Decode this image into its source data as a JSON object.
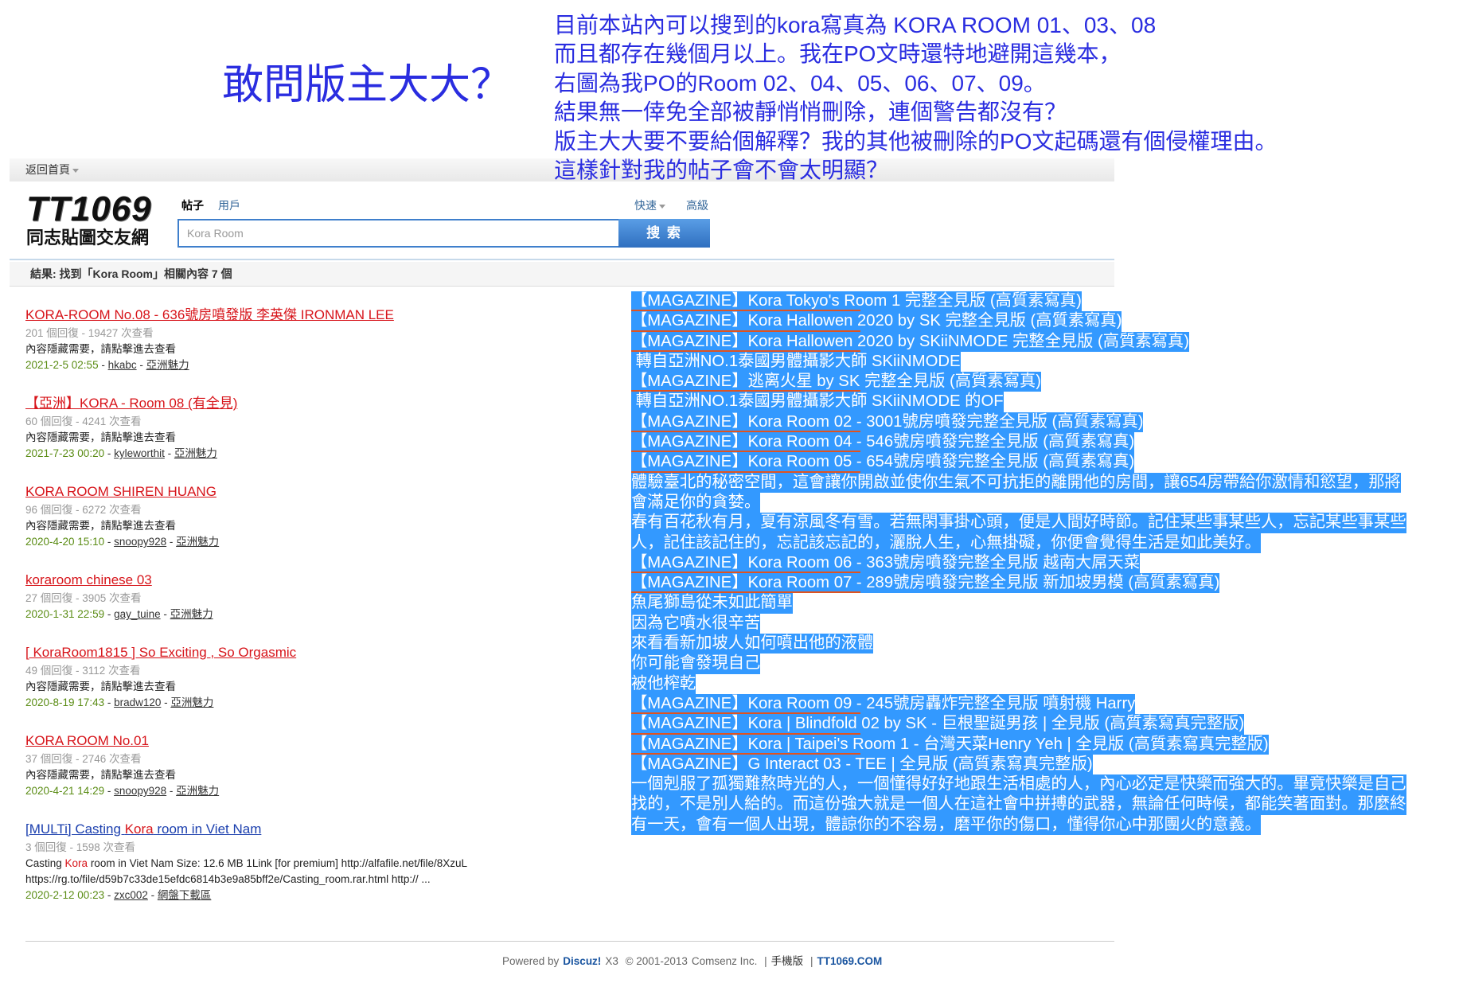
{
  "colors": {
    "annotation_blue": "#2a2de0",
    "selection_highlight": "#3399ff",
    "title_red": "#d7141a",
    "title_blue": "#1b3fae",
    "date_green": "#5a8c14",
    "underline_orange": "#e0531f"
  },
  "annotation": {
    "title": "敢問版主大大？",
    "lines": [
      "目前本站內可以搜到的kora寫真為 KORA ROOM 01、03、08",
      "而且都存在幾個月以上。我在PO文時還特地避開這幾本，",
      "右圖為我PO的Room 02、04、05、06、07、09。",
      "結果無一倖免全部被靜悄悄刪除，連個警告都沒有？",
      "版主大大要不要給個解釋？我的其他被刪除的PO文起碼還有個侵權理由。",
      "這樣針對我的帖子會不會太明顯？"
    ]
  },
  "topbar": {
    "home_label": "返回首頁"
  },
  "logo": {
    "main": "TT1069",
    "sub": "同志貼圖交友網"
  },
  "search": {
    "tabs": [
      {
        "label": "帖子",
        "active": true
      },
      {
        "label": "用戶",
        "active": false
      }
    ],
    "quick_label": "快速",
    "advanced_label": "高級",
    "value": "Kora Room",
    "button_label": "搜 索"
  },
  "results_header": "結果: 找到「Kora Room」相關內容 7 個",
  "result_separator": " - ",
  "results": [
    {
      "title_style": "red",
      "title": [
        {
          "text": "KORA-ROOM No.08 - 636號房噴發版 李英傑 IRONMAN LEE",
          "hl": false
        }
      ],
      "stats": "201 個回復 - 19427 次查看",
      "content": [
        [
          {
            "text": "內容隱藏需要，請點擊進去查看",
            "hl": false
          }
        ]
      ],
      "date": "2021-2-5 02:55",
      "author": "hkabc",
      "forum": "亞洲魅力"
    },
    {
      "title_style": "red",
      "title": [
        {
          "text": "【亞洲】KORA - Room 08 (有全見)",
          "hl": false
        }
      ],
      "stats": "60 個回復 - 4241 次查看",
      "content": [
        [
          {
            "text": "內容隱藏需要，請點擊進去查看",
            "hl": false
          }
        ]
      ],
      "date": "2021-7-23 00:20",
      "author": "kyleworthit",
      "forum": "亞洲魅力"
    },
    {
      "title_style": "red",
      "title": [
        {
          "text": "KORA ROOM SHIREN HUANG",
          "hl": false
        }
      ],
      "stats": "96 個回復 - 6272 次查看",
      "content": [
        [
          {
            "text": "內容隱藏需要，請點擊進去查看",
            "hl": false
          }
        ]
      ],
      "date": "2020-4-20 15:10",
      "author": "snoopy928",
      "forum": "亞洲魅力"
    },
    {
      "title_style": "red",
      "title": [
        {
          "text": "koraroom chinese 03",
          "hl": false
        }
      ],
      "stats": "27 個回復 - 3905 次查看",
      "content": [],
      "date": "2020-1-31 22:59",
      "author": "gay_tuine",
      "forum": "亞洲魅力"
    },
    {
      "title_style": "red",
      "title": [
        {
          "text": "[ KoraRoom1815 ] So Exciting , So Orgasmic",
          "hl": false
        }
      ],
      "stats": "49 個回復 - 3112 次查看",
      "content": [
        [
          {
            "text": "內容隱藏需要，請點擊進去查看",
            "hl": false
          }
        ]
      ],
      "date": "2020-8-19 17:43",
      "author": "bradw120",
      "forum": "亞洲魅力"
    },
    {
      "title_style": "red",
      "title": [
        {
          "text": "KORA ROOM No.01",
          "hl": false
        }
      ],
      "stats": "37 個回復 - 2746 次查看",
      "content": [
        [
          {
            "text": "內容隱藏需要，請點擊進去查看",
            "hl": false
          }
        ]
      ],
      "date": "2020-4-21 14:29",
      "author": "snoopy928",
      "forum": "亞洲魅力"
    },
    {
      "title_style": "blue",
      "title": [
        {
          "text": "[MULTi] Casting ",
          "hl": false
        },
        {
          "text": "Kora",
          "hl": true
        },
        {
          "text": " room in Viet Nam",
          "hl": false
        }
      ],
      "stats": "3 個回復 - 1598 次查看",
      "content": [
        [
          {
            "text": "Casting ",
            "hl": false
          },
          {
            "text": "Kora",
            "hl": true
          },
          {
            "text": " room in Viet Nam Size: 12.6 MB 1Link [for premium] http://alfafile.net/file/8XzuL",
            "hl": false
          }
        ],
        [
          {
            "text": "https://rg.to/file/d59b7c33de15efdc6814b3e9a85bff2e/Casting_room.rar.html http:// ...",
            "hl": false
          }
        ]
      ],
      "date": "2020-2-12 00:23",
      "author": "zxc002",
      "forum": "網盤下載區"
    }
  ],
  "selection_lines": [
    {
      "text": "【MAGAZINE】Kora Tokyo's Room 1 完整全見版 (高質素寫真)",
      "underline": true
    },
    {
      "text": "【MAGAZINE】Kora Hallowen 2020 by SK 完整全見版 (高質素寫真)",
      "underline": true
    },
    {
      "text": "【MAGAZINE】Kora Hallowen 2020 by SKiiNMODE 完整全見版 (高質素寫真)",
      "underline": true
    },
    {
      "text": " 轉自亞洲NO.1泰國男體攝影大師 SKiiNMODE",
      "underline": false
    },
    {
      "text": "【MAGAZINE】逃离火星 by SK 完整全見版 (高質素寫真)",
      "underline": true
    },
    {
      "text": " 轉自亞洲NO.1泰國男體攝影大師 SKiiNMODE 的OF",
      "underline": false
    },
    {
      "text": "【MAGAZINE】Kora Room 02 - 3001號房噴發完整全見版 (高質素寫真)",
      "underline": true
    },
    {
      "text": "【MAGAZINE】Kora Room 04 - 546號房噴發完整全見版 (高質素寫真)",
      "underline": true
    },
    {
      "text": "【MAGAZINE】Kora Room 05 - 654號房噴發完整全見版 (高質素寫真)",
      "underline": true
    },
    {
      "text": "體驗臺北的秘密空間，這會讓你開啟並使你生氣不可抗拒的離開他的房間，讓654房帶給你激情和慾望，那將",
      "underline": false
    },
    {
      "text": "會滿足你的貪婪。",
      "underline": false
    },
    {
      "text": "春有百花秋有月，夏有涼風冬有雪。若無閑事掛心頭，便是人間好時節。記住某些事某些人，忘記某些事某些",
      "underline": false
    },
    {
      "text": "人，記住該記住的，忘記該忘記的，灑脫人生，心無掛礙，你便會覺得生活是如此美好。",
      "underline": false
    },
    {
      "text": "【MAGAZINE】Kora Room 06 - 363號房噴發完整全見版 越南大屌天菜",
      "underline": true
    },
    {
      "text": "【MAGAZINE】Kora Room 07 - 289號房噴發完整全見版 新加坡男模 (高質素寫真)",
      "underline": true
    },
    {
      "text": "魚尾獅島從未如此簡單",
      "underline": false
    },
    {
      "text": "因為它噴水很辛苦",
      "underline": false
    },
    {
      "text": "來看看新加坡人如何噴出他的液體",
      "underline": false
    },
    {
      "text": "你可能會發現自己",
      "underline": false
    },
    {
      "text": "被他榨乾",
      "underline": false
    },
    {
      "text": "【MAGAZINE】Kora Room 09 - 245號房轟炸完整全見版 噴射機 Harry",
      "underline": true
    },
    {
      "text": "【MAGAZINE】Kora | Blindfold 02 by SK - 巨根聖誕男孩 | 全見版 (高質素寫真完整版)",
      "underline": true
    },
    {
      "text": "【MAGAZINE】Kora | Taipei's Room 1 - 台灣天菜Henry Yeh | 全見版 (高質素寫真完整版)",
      "underline": true
    },
    {
      "text": "【MAGAZINE】G Interact 03 - TEE | 全見版 (高質素寫真完整版)",
      "underline": false
    },
    {
      "text": "一個剋服了孤獨難熬時光的人，一個懂得好好地跟生活相處的人，內心必定是快樂而強大的。畢竟快樂是自己",
      "underline": false
    },
    {
      "text": "找的，不是別人給的。而這份強大就是一個人在這社會中拼搏的武器，無論任何時候，都能笑著面對。那麼終",
      "underline": false
    },
    {
      "text": "有一天，會有一個人出現，體諒你的不容易，磨平你的傷口，懂得你心中那團火的意義。",
      "underline": false
    }
  ],
  "footer": {
    "powered": "Powered by",
    "brand": "Discuz!",
    "version": "X3",
    "copyright": "© 2001-2013",
    "company": "Comsenz Inc.",
    "sep": "|",
    "mobile": "手機版",
    "site": "TT1069.COM"
  }
}
